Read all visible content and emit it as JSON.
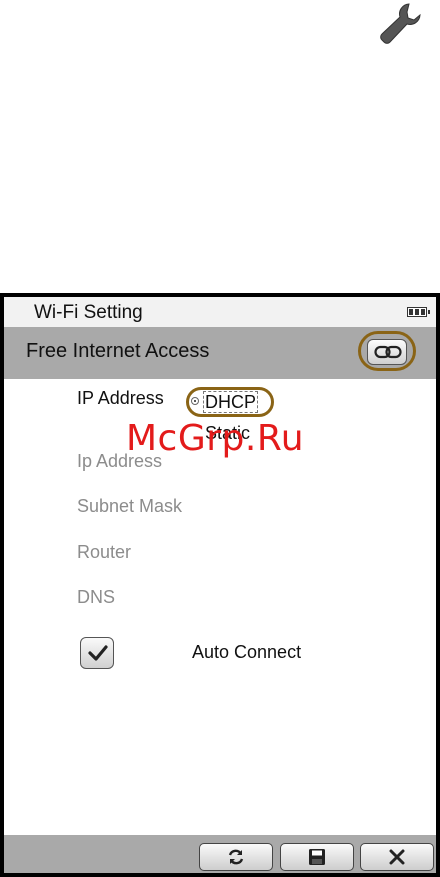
{
  "toolbar_top": {
    "icon": "wrench-icon"
  },
  "status_bar": {
    "title": "Wi-Fi Setting",
    "battery_icon": "battery-icon"
  },
  "header": {
    "network_name": "Free Internet Access",
    "connect_icon": "link-icon"
  },
  "form": {
    "ip_address_label": "IP Address",
    "mode_options": [
      {
        "label": "DHCP",
        "selected": true
      },
      {
        "label": "Static",
        "selected": false
      }
    ],
    "fields": [
      {
        "label": "Ip Address"
      },
      {
        "label": "Subnet Mask"
      },
      {
        "label": "Router"
      },
      {
        "label": "DNS"
      }
    ],
    "auto_connect": {
      "label": "Auto Connect",
      "checked": true
    }
  },
  "watermark": "McGrp.Ru",
  "bottom_bar": {
    "buttons": [
      {
        "icon": "refresh-icon"
      },
      {
        "icon": "save-icon"
      },
      {
        "icon": "close-icon"
      }
    ]
  },
  "colors": {
    "highlight_ring": "#8a6416",
    "bar_gray": "#a9a9a9",
    "watermark": "#e31b1b"
  }
}
